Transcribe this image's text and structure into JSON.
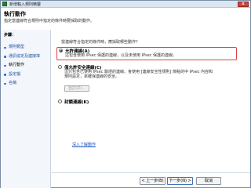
{
  "window": {
    "title": "新增輸入規則精靈",
    "close_label": "x"
  },
  "header": {
    "title": "執行動作",
    "description": "指定當連線符合規則中指定的條件時要採取的動作。"
  },
  "sidebar": {
    "steps_label": "步驟：",
    "steps": [
      {
        "label": "規則類型"
      },
      {
        "label": "通訊協定及連接埠"
      },
      {
        "label": "執行動作"
      },
      {
        "label": "設定檔"
      },
      {
        "label": "名稱"
      }
    ]
  },
  "main": {
    "question": "當連線符合指定的條件時，應採取哪些動作？",
    "options": [
      {
        "label": "允許連線(A)",
        "description": [
          "這包含使用 IPsec 保護的連線，以及未使用 IPsec 保護的連線。"
        ],
        "selected": true
      },
      {
        "label": "僅允許安全連線(C)",
        "description": [
          "這只包含已使用 IPsec 驗證的連線。會使用 [連線安全性規則] 節點的中 IPsec 內容和",
          "規則設定，來確保連線的安全。"
        ],
        "selected": false,
        "customize_label": "自訂(Z)..."
      },
      {
        "label": "封鎖連線(K)",
        "description": [],
        "selected": false
      }
    ],
    "learn_more_link": "深入了解動作"
  },
  "footer": {
    "back_label": "< 上一步(B)",
    "next_label": "下一步(N) >",
    "cancel_label": "取消"
  },
  "colors": {
    "highlight_border": "#dd4444",
    "link": "#1a55c0",
    "sidebar_bg": "#f3f6fb"
  }
}
